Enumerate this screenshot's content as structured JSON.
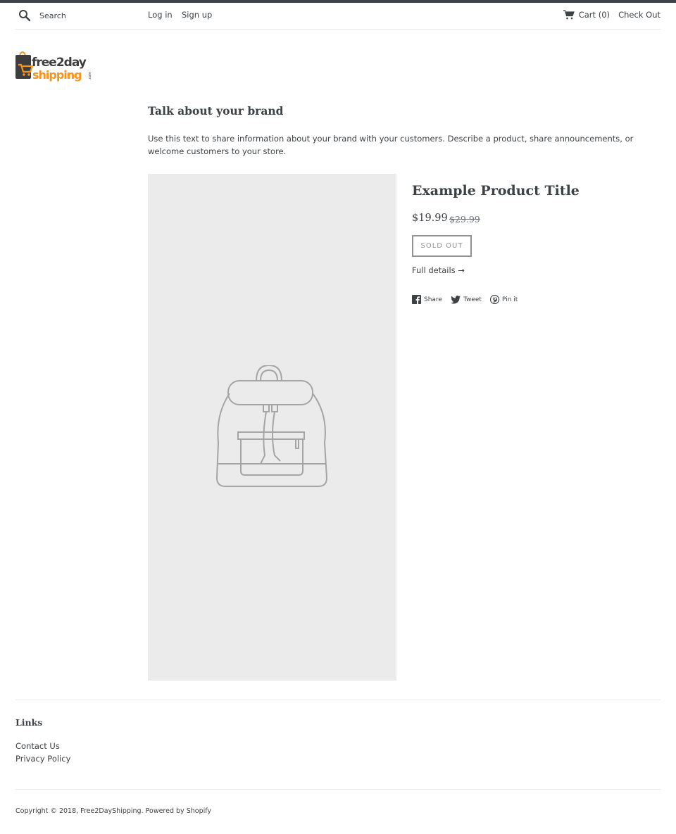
{
  "header": {
    "search_placeholder": "Search",
    "login_label": "Log in",
    "signup_label": "Sign up",
    "cart_label": "Cart (0)",
    "checkout_label": "Check Out",
    "icons": {
      "search": "search-icon",
      "cart": "cart-icon"
    }
  },
  "logo": {
    "text_line1": "free2day",
    "text_line2": "shipping",
    "text_suffix": ".com",
    "accent_color": "#f7941d",
    "dark_color": "#3d3d3d"
  },
  "brand": {
    "title": "Talk about your brand",
    "text": "Use this text to share information about your brand with your customers. Describe a product, share announcements, or welcome customers to your store."
  },
  "product": {
    "title": "Example Product Title",
    "price": "$19.99",
    "compare_price": "$29.99",
    "sold_out_label": "SOLD OUT",
    "full_details_label": "Full details →",
    "image_icon": "backpack-placeholder-icon"
  },
  "share": {
    "facebook_label": "Share",
    "twitter_label": "Tweet",
    "pinterest_label": "Pin it"
  },
  "footer": {
    "links_title": "Links",
    "links": [
      "Contact Us",
      "Privacy Policy"
    ],
    "copyright": "Copyright © 2018, Free2DayShipping. Powered by Shopify"
  },
  "colors": {
    "text": "#3d4246",
    "muted": "#69727b",
    "border": "#e8e9eb",
    "image_bg": "#ebebeb",
    "button_border": "#939393"
  }
}
